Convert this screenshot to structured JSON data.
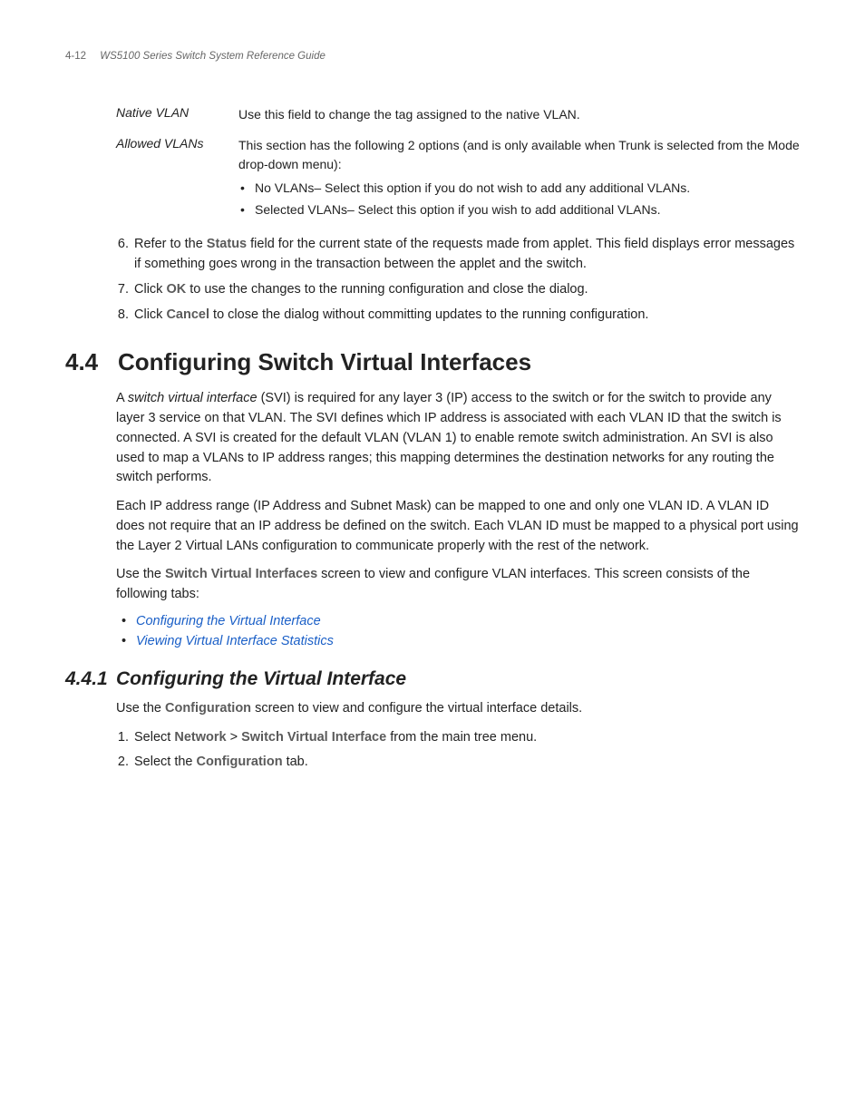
{
  "header": {
    "page_number": "4-12",
    "doc_title": "WS5100 Series Switch System Reference Guide"
  },
  "definitions": [
    {
      "term": "Native VLAN",
      "desc": "Use this field to change the tag assigned to the native VLAN."
    },
    {
      "term": "Allowed VLANs",
      "desc": "This section has the following 2 options (and is only available when Trunk is selected from the Mode drop-down menu):",
      "bullets": [
        "No VLANs– Select this option if you do not wish to add any additional VLANs.",
        "Selected VLANs– Select this option if you wish to add additional VLANs."
      ]
    }
  ],
  "steps_top": {
    "start": 6,
    "items": [
      {
        "pre": "Refer to the ",
        "bold": "Status",
        "post": " field for the current state of the requests made from applet. This field displays error messages if something goes wrong in the transaction between the applet and the switch."
      },
      {
        "pre": "Click ",
        "bold": "OK",
        "post": " to use the changes to the running configuration and close the dialog."
      },
      {
        "pre": "Click ",
        "bold": "Cancel",
        "post": " to close the dialog without committing updates to the running configuration."
      }
    ]
  },
  "section": {
    "number": "4.4",
    "title": "Configuring Switch Virtual Interfaces",
    "para1_a": "A ",
    "para1_ital": "switch virtual interface",
    "para1_b": " (SVI) is required for any layer 3 (IP) access to the switch or for the switch to provide any layer 3 service on that VLAN. The SVI defines which IP address is associated with each VLAN ID that the switch is connected. A SVI is created for the default VLAN (VLAN 1) to enable remote switch administration. An SVI is also used to map a VLANs to IP address ranges; this mapping determines the destination networks for any routing the switch performs.",
    "para2": "Each IP address range (IP Address and Subnet Mask) can be mapped to one and only one VLAN ID. A VLAN ID does not require that an IP address be defined on the switch. Each VLAN ID must be mapped to a physical port using the Layer 2 Virtual LANs configuration to communicate properly with the rest of the network.",
    "para3_a": "Use the ",
    "para3_bold": "Switch Virtual Interfaces",
    "para3_b": " screen to view and configure VLAN interfaces. This screen consists of the following tabs:",
    "links": [
      "Configuring the Virtual Interface",
      "Viewing Virtual Interface Statistics"
    ]
  },
  "subsection": {
    "number": "4.4.1",
    "title": "Configuring the Virtual Interface",
    "intro_a": "Use the ",
    "intro_bold": "Configuration",
    "intro_b": " screen to view and configure the virtual interface details.",
    "steps": [
      {
        "pre": "Select ",
        "bold1": "Network",
        "mid": " > ",
        "bold2": "Switch Virtual Interface",
        "post": " from the main tree menu."
      },
      {
        "pre": "Select the ",
        "bold1": "Configuration",
        "post": " tab."
      }
    ]
  }
}
